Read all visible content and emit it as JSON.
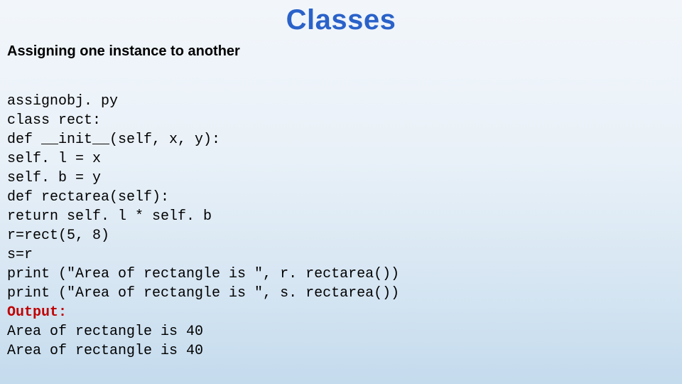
{
  "title": "Classes",
  "subtitle": "Assigning one instance to another",
  "code": {
    "l1": "assignobj. py",
    "l2": "class rect:",
    "l3": "def __init__(self, x, y):",
    "l4": "self. l = x",
    "l5": "self. b = y",
    "l6": "def rectarea(self):",
    "l7": "return self. l * self. b",
    "l8": "r=rect(5, 8)",
    "l9": "s=r",
    "l10": "print (\"Area of rectangle is \", r. rectarea())",
    "l11": "print (\"Area of rectangle is \", s. rectarea())",
    "l12": "Output:",
    "l13": "Area of rectangle is 40",
    "l14": "Area of rectangle is 40"
  }
}
